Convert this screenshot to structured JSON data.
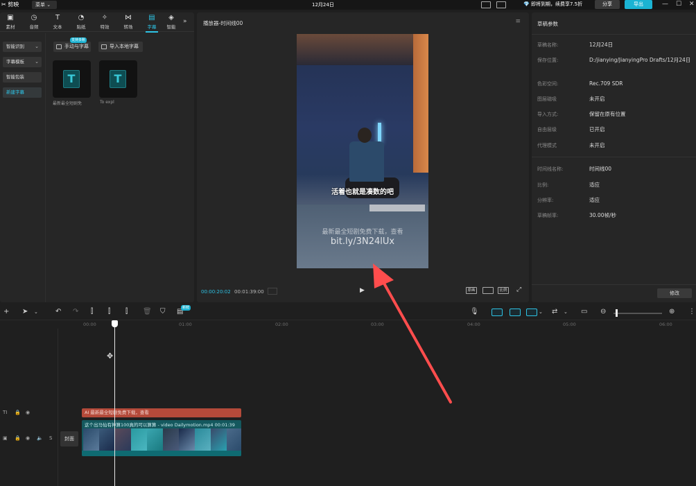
{
  "titlebar": {
    "app_name": "剪映",
    "menu_label": "菜单",
    "title": "12月24日",
    "promo": "即将到期，续费享7.5折",
    "share_label": "分享",
    "export_label": "导出"
  },
  "toolbar": {
    "items": [
      {
        "label": "素材",
        "icon": "media-icon"
      },
      {
        "label": "音频",
        "icon": "audio-icon"
      },
      {
        "label": "文本",
        "icon": "text-icon"
      },
      {
        "label": "贴纸",
        "icon": "sticker-icon"
      },
      {
        "label": "特效",
        "icon": "effects-icon"
      },
      {
        "label": "转场",
        "icon": "transition-icon"
      },
      {
        "label": "字幕",
        "icon": "caption-icon"
      },
      {
        "label": "智能",
        "icon": "smart-icon"
      }
    ],
    "active_index": 6
  },
  "sidenav": {
    "items": [
      {
        "label": "智能识别"
      },
      {
        "label": "字幕模板"
      },
      {
        "label": "智能包装"
      },
      {
        "label": "新建字幕"
      }
    ],
    "active_index": 3
  },
  "caption_panel": {
    "manual_label": "手动与字幕",
    "new_badge": "支持多账",
    "import_label": "导入本地字幕",
    "thumbnails": [
      {
        "label": "最新最全短剧免"
      },
      {
        "label": "To expl"
      }
    ]
  },
  "player": {
    "title": "播放器-时间线00",
    "subtitle_text": "活着也就是凑数的吧",
    "watermark_line1": "最新最全短剧免费下载，查看",
    "watermark_line2": "bit.ly/3N24lUx",
    "current_time": "00:00:20:02",
    "total_time": "00:01:39:00",
    "buttons": [
      "原画",
      "比例"
    ]
  },
  "properties": {
    "title": "草稿参数",
    "rows": [
      {
        "label": "草稿名称:",
        "value": "12月24日"
      },
      {
        "label": "保存位置:",
        "value": "D:/jianying/JianyingPro Drafts/12月24日"
      },
      {
        "label": "色彩空间:",
        "value": "Rec.709 SDR"
      },
      {
        "label": "图层磁吸",
        "value": "未开启"
      },
      {
        "label": "导入方式:",
        "value": "保留在原有位置"
      },
      {
        "label": "自由层级",
        "value": "已开启"
      },
      {
        "label": "代理模式",
        "value": "未开启"
      }
    ],
    "rows2": [
      {
        "label": "时间线名称:",
        "value": "时间线00"
      },
      {
        "label": "比例:",
        "value": "适应"
      },
      {
        "label": "分辨率:",
        "value": "适应"
      },
      {
        "label": "草稿帧率:",
        "value": "30.00帧/秒"
      }
    ],
    "edit_label": "修改"
  },
  "timeline": {
    "badge": "新鲜",
    "ruler": [
      "00:00",
      "01:00",
      "02:00",
      "03:00",
      "04:00",
      "05:00",
      "06:00"
    ],
    "subtitle_clip": "AI 最新最全短剧免费下载，查看",
    "video_clip": "这个出马仙有神算100真的可以算算 - video Dailymotion.mp4  00:01:39",
    "cover_label": "封面"
  },
  "colors": {
    "accent": "#2ec4e6",
    "subtitle_clip": "#b44a3a",
    "video_clip": "#14585e",
    "arrow": "#ff4d4d"
  }
}
